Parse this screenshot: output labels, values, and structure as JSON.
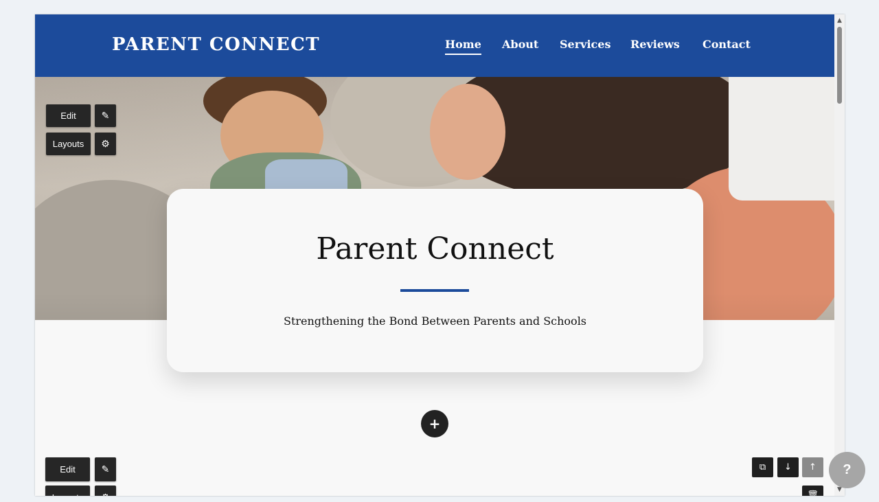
{
  "header": {
    "logo": "PARENT CONNECT",
    "nav": [
      "Home",
      "About",
      "Services",
      "Reviews",
      "Contact"
    ],
    "active_nav": "Home"
  },
  "hero": {
    "title": "Parent Connect",
    "subtitle": "Strengthening the Bond Between Parents and Schools"
  },
  "editor": {
    "edit_label": "Edit",
    "layouts_label": "Layouts",
    "magic_icon": "✎",
    "settings_icon": "⚙",
    "add_icon": "+",
    "copy_icon": "⧉",
    "move_down_icon": "↓",
    "move_up_icon": "↑",
    "delete_icon": "🗑"
  },
  "help": {
    "label": "?"
  },
  "colors": {
    "brand": "#1c4b9b",
    "toolbar": "#262626",
    "page_bg": "#f8f8f8"
  }
}
